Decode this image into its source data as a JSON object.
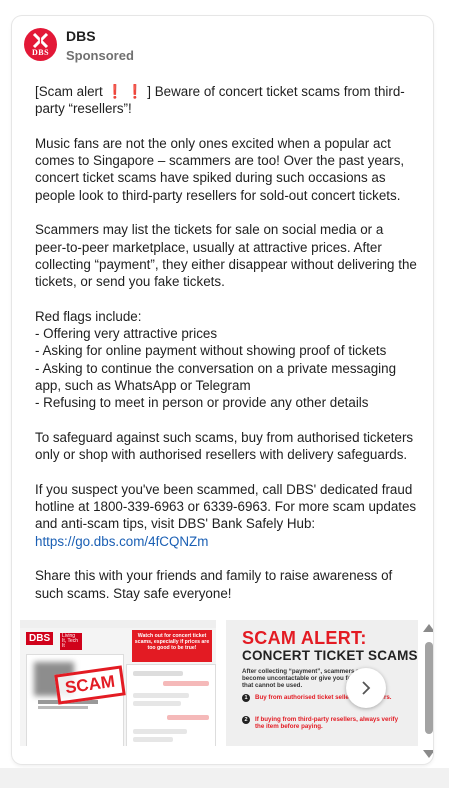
{
  "advertiser": {
    "name": "DBS",
    "logo_text": "DBS",
    "sponsored_label": "Sponsored",
    "brand_color": "#e31837"
  },
  "post": {
    "intro_before": "[Scam alert ",
    "flags": "❗ ❗",
    "intro_after": " ] Beware of concert ticket scams from third-party “resellers”!",
    "paragraph_1": "Music fans are not the only ones excited when a popular act comes to Singapore – scammers are too! Over the past years, concert ticket scams have spiked during such occasions as people look to third-party resellers for sold-out concert tickets.",
    "paragraph_2": "Scammers may list the tickets for sale on social media or a peer-to-peer marketplace, usually at attractive prices. After collecting “payment”, they either disappear without delivering the tickets, or send you fake tickets.",
    "red_flags_heading": "Red flags include:",
    "red_flags": [
      "- Offering very attractive prices",
      "- Asking for online payment without showing proof of tickets",
      "- Asking to continue the conversation on a private messaging app, such as WhatsApp or Telegram",
      "- Refusing to meet in person or provide any other details"
    ],
    "paragraph_3": "To safeguard against such scams, buy from authorised ticketers only or shop with authorised resellers with delivery safeguards.",
    "paragraph_4": "If you suspect you've been scammed, call DBS' dedicated fraud hotline at 1800-339-6963 or 6339-6963.  For more scam updates and anti-scam tips, visit DBS' Bank Safely Hub:",
    "link": "https://go.dbs.com/4fCQNZm",
    "link_color": "#1a5fb4",
    "paragraph_5": "Share this with your friends and family to raise awareness of such scams. Stay safe everyone!"
  },
  "carousel": {
    "slide_1": {
      "logo": "DBS",
      "logo_sub": "Living It, Tech It",
      "callout": "Watch out for concert ticket scams, especially if prices are too good to be true!",
      "stamp": "SCAM"
    },
    "slide_2": {
      "title": "SCAM ALERT:",
      "subtitle": "CONCERT TICKET SCAMS",
      "description": "After collecting “payment”, scammers may become uncontactable or give you fake tickets that cannot be used.",
      "tips": [
        {
          "num": "1",
          "text": "Buy from authorised ticket sellers or resellers."
        },
        {
          "num": "2",
          "text": "If buying from third-party resellers, always verify the item before paying."
        }
      ],
      "accent_color": "#e31b23"
    },
    "next_icon": "chevron-right-icon"
  }
}
